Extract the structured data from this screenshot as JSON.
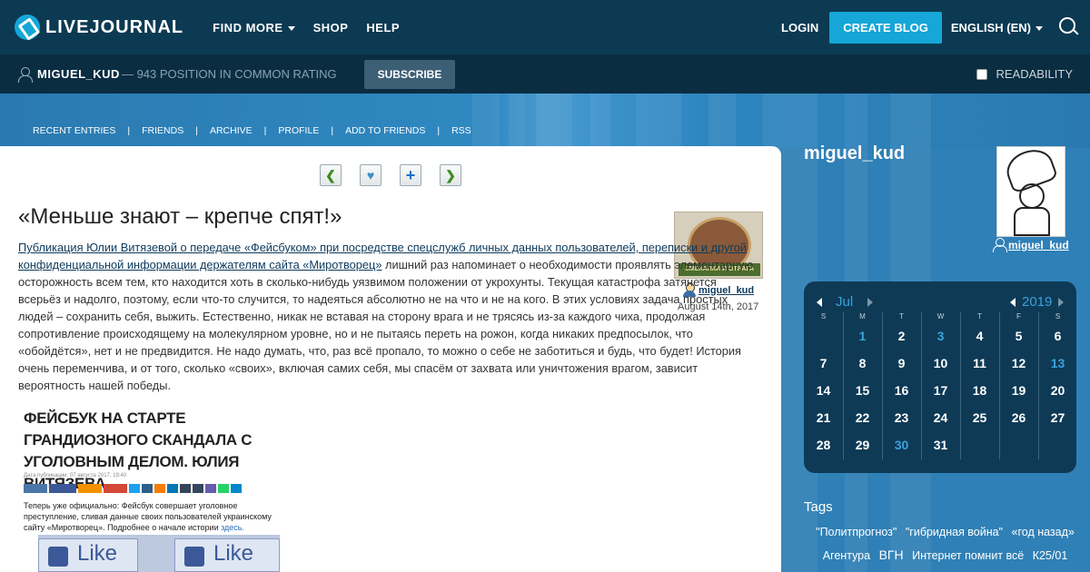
{
  "header": {
    "logo_text": "LIVEJOURNAL",
    "nav": [
      {
        "label": "FIND MORE",
        "dropdown": true
      },
      {
        "label": "SHOP",
        "dropdown": false
      },
      {
        "label": "HELP",
        "dropdown": false
      }
    ],
    "login_label": "LOGIN",
    "create_blog_label": "CREATE BLOG",
    "language_label": "ENGLISH (EN)"
  },
  "userbar": {
    "username": "MIGUEL_KUD",
    "rating_text": "— 943 POSITION IN COMMON RATING",
    "subscribe_label": "SUBSCRIBE",
    "readability_label": "READABILITY"
  },
  "journal_nav": [
    "RECENT ENTRIES",
    "FRIENDS",
    "ARCHIVE",
    "PROFILE",
    "ADD TO FRIENDS",
    "RSS"
  ],
  "post": {
    "title": "«Меньше знают – крепче спят!»",
    "link_text": "Публикация Юлии Витязевой о передаче «Фейсбуком» при посредстве спецслужб личных данных пользователей, переписки и другой конфиденциальной информации держателям сайта «Миротворец»",
    "body_text": " лишний раз напоминает о необходимости проявлять элементарную осторожность всем тем, кто находится хоть в сколько-нибудь уязвимом положении от укрохунты. Текущая катастрофа затянется всерьёз и надолго, поэтому, если что-то случится, то надеяться абсолютно не на что и не на кого. В этих условиях задача простых людей – сохранить себя, выжить. Естественно, никак не вставая на сторону врага и не трясясь из-за каждого чиха, продолжая сопротивление происходящему на молекулярном уровне, но и не пытаясь переть на рожон, когда никаких предпосылок, что «обойдётся», нет и не предвидится. Не надо думать, что, раз всё пропало, то можно о себе не заботиться и будь, что будет! История очень переменчива, и от того, сколько «своих», включая самих себя, мы спасём от захвата или уничтожения врагом, зависит вероятность нашей победы.",
    "author": "miguel_kud",
    "date": "August 14th, 2017",
    "userpic_banner": "СМЕКАЛКИ И ОТВАГА",
    "screenshot": {
      "headline": "ФЕЙСБУК НА СТАРТЕ ГРАНДИОЗНОГО СКАНДАЛА С УГОЛОВНЫМ ДЕЛОМ. ЮЛИЯ ВИТЯЗЕВА",
      "date_line": "Дата публикации: 07 августа 2017, 19:40",
      "text": "Теперь уже официально: Фейсбук совершает уголовное преступление, сливая данные своих пользователей украинскому сайту «Миротворец». Подробнее о начале истории ",
      "link": "здесь.",
      "like_label": "Like"
    }
  },
  "sidebar": {
    "name": "miguel_kud",
    "user_link": "miguel_kud",
    "calendar": {
      "month": "Jul",
      "year": "2019",
      "dow": [
        "S",
        "M",
        "T",
        "W",
        "T",
        "F",
        "S"
      ],
      "weeks": [
        [
          "",
          "1",
          "2",
          "3",
          "4",
          "5",
          "6"
        ],
        [
          "7",
          "8",
          "9",
          "10",
          "11",
          "12",
          "13"
        ],
        [
          "14",
          "15",
          "16",
          "17",
          "18",
          "19",
          "20"
        ],
        [
          "21",
          "22",
          "23",
          "24",
          "25",
          "26",
          "27"
        ],
        [
          "28",
          "29",
          "30",
          "31",
          "",
          "",
          ""
        ]
      ],
      "linked_days": [
        "1",
        "3",
        "13",
        "30"
      ]
    },
    "tags_title": "Tags",
    "tags": [
      "\"Политпрогноз\"",
      "\"гибридная война\"",
      "«год назад»",
      "Агентура",
      "ВГН",
      "Интернет помнит всё",
      "К25/01"
    ]
  }
}
